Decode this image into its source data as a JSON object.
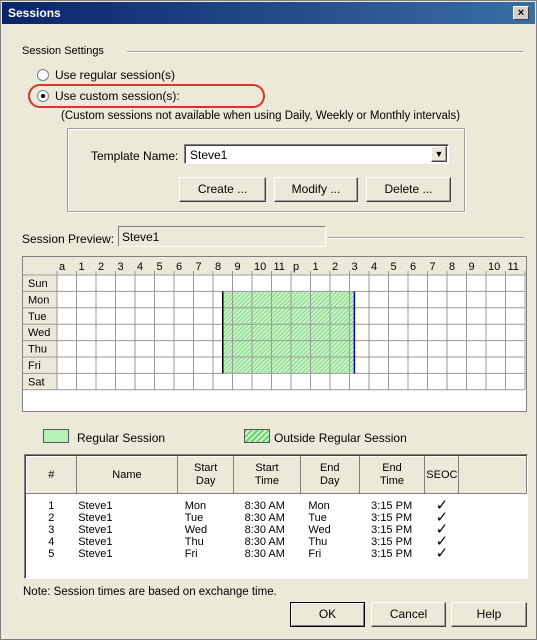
{
  "window": {
    "title": "Sessions",
    "close_symbol": "×"
  },
  "settings": {
    "group_label": "Session Settings",
    "radio_regular": "Use regular session(s)",
    "radio_custom": "Use custom session(s):",
    "selected": "custom",
    "note": "(Custom sessions not available when using Daily, Weekly or Monthly intervals)",
    "template_label": "Template Name:",
    "template_value": "Steve1",
    "create_button": "Create ...",
    "modify_button": "Modify ...",
    "delete_button": "Delete ..."
  },
  "preview": {
    "label": "Session Preview:",
    "value": "Steve1",
    "hours": [
      "a",
      "1",
      "2",
      "3",
      "4",
      "5",
      "6",
      "7",
      "8",
      "9",
      "10",
      "11",
      "p",
      "1",
      "2",
      "3",
      "4",
      "5",
      "6",
      "7",
      "8",
      "9",
      "10",
      "11"
    ],
    "days": [
      "Sun",
      "Mon",
      "Tue",
      "Wed",
      "Thu",
      "Fri",
      "Sat"
    ],
    "session_days": [
      "Mon",
      "Tue",
      "Wed",
      "Thu",
      "Fri"
    ],
    "session_start_hour": 8.5,
    "session_end_hour": 15.25,
    "colors": {
      "session_fill": "#b6f2b6",
      "boundary_start": "#000000",
      "boundary_end": "#0000cc",
      "highlight_oval": "#e03030"
    }
  },
  "legend": {
    "regular": "Regular Session",
    "outside": "Outside Regular Session"
  },
  "table": {
    "headers": {
      "num": "#",
      "name": "Name",
      "start_day": "Start Day",
      "start_time": "Start Time",
      "end_day": "End Day",
      "end_time": "End Time",
      "seoc": "SEOC"
    },
    "rows": [
      {
        "num": "1",
        "name": "Steve1",
        "start_day": "Mon",
        "start_time": "8:30 AM",
        "end_day": "Mon",
        "end_time": "3:15 PM",
        "seoc": "✓"
      },
      {
        "num": "2",
        "name": "Steve1",
        "start_day": "Tue",
        "start_time": "8:30 AM",
        "end_day": "Tue",
        "end_time": "3:15 PM",
        "seoc": "✓"
      },
      {
        "num": "3",
        "name": "Steve1",
        "start_day": "Wed",
        "start_time": "8:30 AM",
        "end_day": "Wed",
        "end_time": "3:15 PM",
        "seoc": "✓"
      },
      {
        "num": "4",
        "name": "Steve1",
        "start_day": "Thu",
        "start_time": "8:30 AM",
        "end_day": "Thu",
        "end_time": "3:15 PM",
        "seoc": "✓"
      },
      {
        "num": "5",
        "name": "Steve1",
        "start_day": "Fri",
        "start_time": "8:30 AM",
        "end_day": "Fri",
        "end_time": "3:15 PM",
        "seoc": "✓"
      }
    ]
  },
  "footer": {
    "note": "Note: Session times are based on exchange time.",
    "ok_button": "OK",
    "cancel_button": "Cancel",
    "help_button": "Help"
  }
}
